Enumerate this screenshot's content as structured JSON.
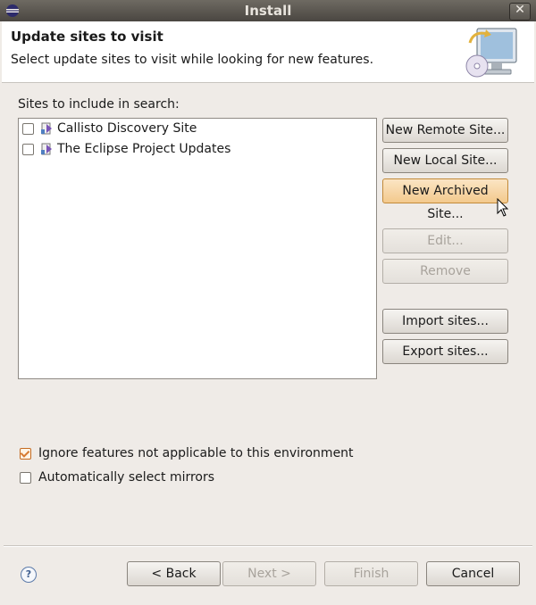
{
  "window": {
    "title": "Install"
  },
  "header": {
    "title": "Update sites to visit",
    "description": "Select update sites to visit while looking for new features."
  },
  "sites": {
    "label": "Sites to include in search:",
    "items": [
      {
        "label": "Callisto Discovery Site",
        "checked": false
      },
      {
        "label": "The Eclipse Project Updates",
        "checked": false
      }
    ]
  },
  "side_buttons": {
    "new_remote": "New Remote Site...",
    "new_local": "New Local Site...",
    "new_archived": "New Archived Site...",
    "edit": "Edit...",
    "remove": "Remove",
    "import": "Import sites...",
    "export": "Export sites..."
  },
  "options": {
    "ignore_features": {
      "label": "Ignore features not applicable to this environment",
      "checked": true
    },
    "auto_mirrors": {
      "label": "Automatically select mirrors",
      "checked": false
    }
  },
  "footer": {
    "back": "< Back",
    "next": "Next >",
    "finish": "Finish",
    "cancel": "Cancel"
  },
  "colors": {
    "accent": "#d7792f",
    "hover": "#f3c98d"
  }
}
